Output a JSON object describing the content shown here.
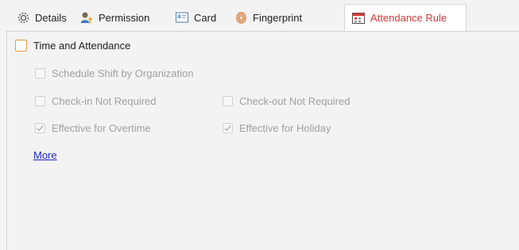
{
  "tabs": [
    {
      "label": "Details",
      "icon": "gear-icon"
    },
    {
      "label": "Permission",
      "icon": "user-key-icon"
    },
    {
      "label": "Card",
      "icon": "card-icon"
    },
    {
      "label": "Fingerprint",
      "icon": "fingerprint-icon"
    },
    {
      "label": "Attendance Rule",
      "icon": "calendar-icon",
      "active": true
    }
  ],
  "section": {
    "title": "Time and Attendance",
    "checked": false
  },
  "options": {
    "schedule_shift": {
      "label": "Schedule Shift by Organization",
      "checked": false,
      "enabled": false
    },
    "checkin_not_required": {
      "label": "Check-in Not Required",
      "checked": false,
      "enabled": false
    },
    "checkout_not_required": {
      "label": "Check-out Not Required",
      "checked": false,
      "enabled": false
    },
    "effective_overtime": {
      "label": "Effective for Overtime",
      "checked": true,
      "enabled": false
    },
    "effective_holiday": {
      "label": "Effective for Holiday",
      "checked": true,
      "enabled": false
    }
  },
  "more_link": "More",
  "colors": {
    "active_tab_text": "#d23a3a",
    "link": "#1a27c9",
    "disabled_text": "#a0a0a0",
    "section_checkbox_border": "#e99a3b"
  }
}
